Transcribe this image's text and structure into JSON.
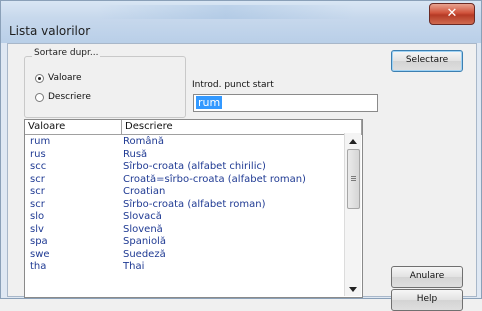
{
  "window": {
    "title": "Lista valorilor",
    "close_glyph": "✕"
  },
  "sort_group": {
    "legend": "Sortare dupr...",
    "options": [
      {
        "label": "Valoare",
        "selected": true
      },
      {
        "label": "Descriere",
        "selected": false
      }
    ]
  },
  "start_point": {
    "label": "Introd. punct start",
    "value": "rum"
  },
  "list": {
    "headers": [
      "Valoare",
      "Descriere"
    ],
    "rows": [
      {
        "value": "rum",
        "desc": "Română"
      },
      {
        "value": "rus",
        "desc": "Rusă"
      },
      {
        "value": "scc",
        "desc": "Sîrbo-croata (alfabet chirilic)"
      },
      {
        "value": "scr",
        "desc": "Croată=sîrbo-croata (alfabet roman)"
      },
      {
        "value": "scr",
        "desc": "Croatian"
      },
      {
        "value": "scr",
        "desc": "Sîrbo-croata (alfabet roman)"
      },
      {
        "value": "slo",
        "desc": "Slovacă"
      },
      {
        "value": "slv",
        "desc": "Slovenă"
      },
      {
        "value": "spa",
        "desc": "Spaniolă"
      },
      {
        "value": "swe",
        "desc": "Suedeză"
      },
      {
        "value": "tha",
        "desc": "Thai"
      }
    ]
  },
  "buttons": {
    "select": "Selectare",
    "cancel": "Anulare",
    "help": "Help"
  }
}
